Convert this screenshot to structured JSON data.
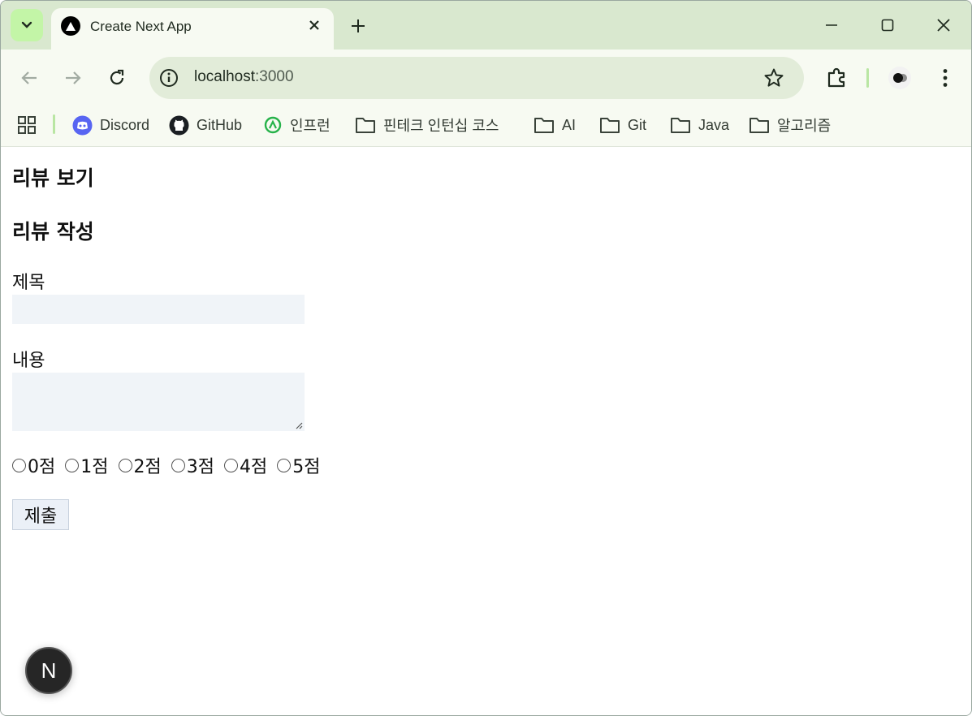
{
  "browser": {
    "tab": {
      "title": "Create Next App"
    },
    "address": {
      "host": "localhost",
      "port": ":3000"
    },
    "bookmarks": [
      {
        "label": "Discord",
        "icon": "discord-icon"
      },
      {
        "label": "GitHub",
        "icon": "github-icon"
      },
      {
        "label": "인프런",
        "icon": "inflearn-icon"
      },
      {
        "label": "핀테크 인턴십 코스",
        "icon": "folder-icon"
      },
      {
        "label": "AI",
        "icon": "folder-icon"
      },
      {
        "label": "Git",
        "icon": "folder-icon"
      },
      {
        "label": "Java",
        "icon": "folder-icon"
      },
      {
        "label": "알고리즘",
        "icon": "folder-icon"
      }
    ]
  },
  "page": {
    "heading_view": "리뷰 보기",
    "heading_write": "리뷰 작성",
    "title_label": "제목",
    "content_label": "내용",
    "ratings": [
      "0점",
      "1점",
      "2점",
      "3점",
      "4점",
      "5점"
    ],
    "submit_label": "제출",
    "next_badge": "N"
  },
  "colors": {
    "tabstrip": "#d9e8cf",
    "toolbar": "#f7faf2",
    "omnibox": "#e2ecd9",
    "field_bg": "#f0f4f8"
  }
}
